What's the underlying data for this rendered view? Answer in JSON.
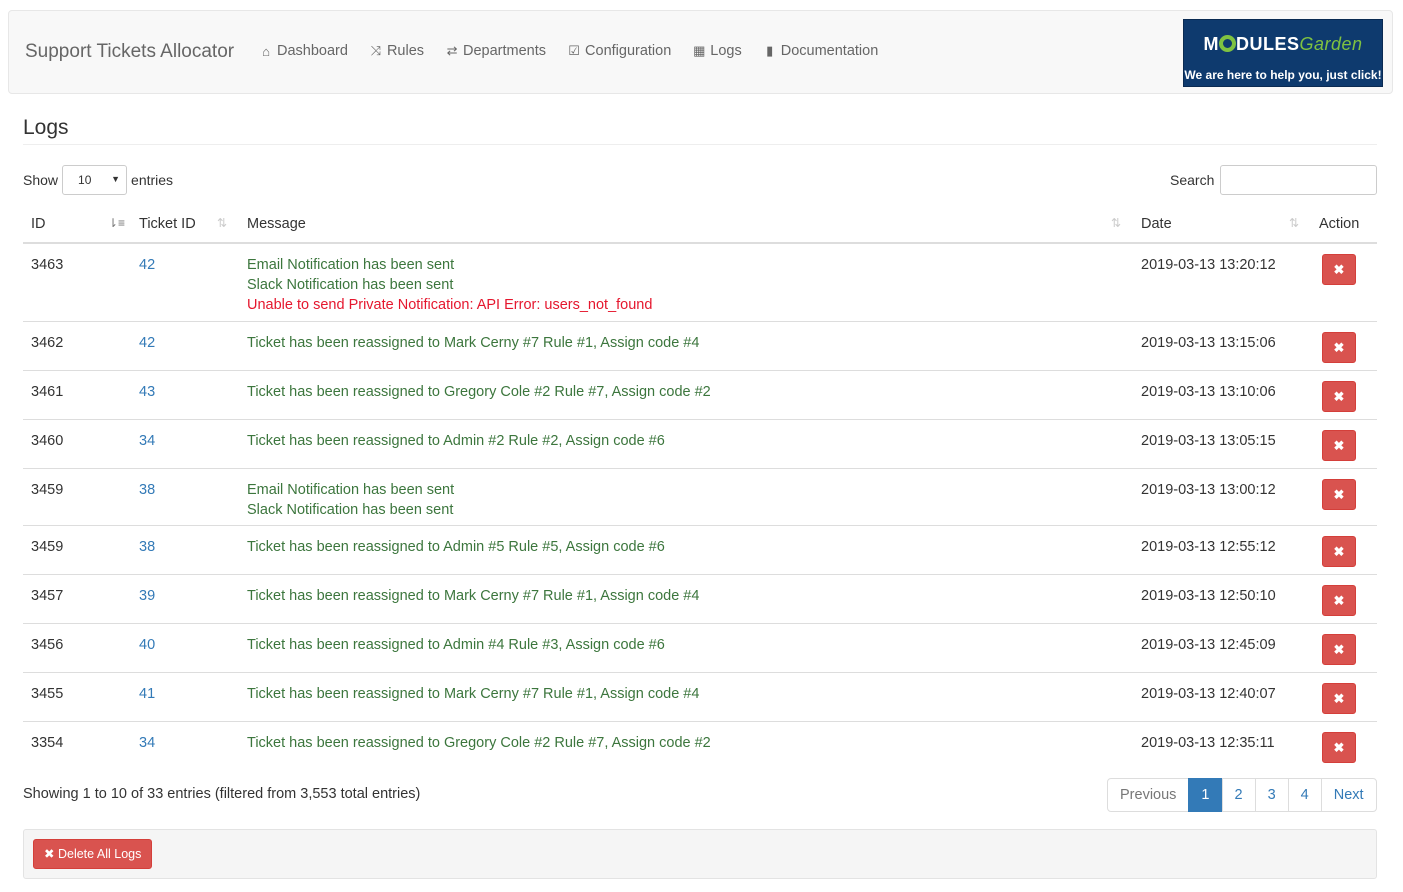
{
  "navbar": {
    "brand": "Support Tickets Allocator",
    "items": [
      {
        "icon": "home-icon",
        "glyph": "⌂",
        "label": "Dashboard"
      },
      {
        "icon": "random-icon",
        "glyph": "⤨",
        "label": "Rules"
      },
      {
        "icon": "transfer-icon",
        "glyph": "⇄",
        "label": "Departments"
      },
      {
        "icon": "check-square-icon",
        "glyph": "☑",
        "label": "Configuration"
      },
      {
        "icon": "calendar-icon",
        "glyph": "▦",
        "label": "Logs"
      },
      {
        "icon": "book-icon",
        "glyph": "▮",
        "label": "Documentation"
      }
    ],
    "logo": {
      "brand_part1": "M",
      "brand_part2": "DULES",
      "brand_part3": "Garden",
      "tagline": "We are here to help you, just click!"
    }
  },
  "page_title": "Logs",
  "table_controls": {
    "show_label": "Show",
    "entries_label": "entries",
    "length_value": "10",
    "search_label": "Search",
    "search_value": ""
  },
  "columns": {
    "id": "ID",
    "ticket_id": "Ticket ID",
    "message": "Message",
    "date": "Date",
    "action": "Action"
  },
  "rows": [
    {
      "id": "3463",
      "ticket_id": "42",
      "messages": [
        {
          "text": "Email Notification has been sent",
          "status": "ok"
        },
        {
          "text": "Slack Notification has been sent",
          "status": "ok"
        },
        {
          "text": "Unable to send Private Notification: API Error: users_not_found",
          "status": "err"
        }
      ],
      "date": "2019-03-13 13:20:12"
    },
    {
      "id": "3462",
      "ticket_id": "42",
      "messages": [
        {
          "text": "Ticket has been reassigned to Mark Cerny #7 Rule #1, Assign code #4",
          "status": "ok"
        }
      ],
      "date": "2019-03-13 13:15:06"
    },
    {
      "id": "3461",
      "ticket_id": "43",
      "messages": [
        {
          "text": "Ticket has been reassigned to Gregory Cole #2 Rule #7, Assign code #2",
          "status": "ok"
        }
      ],
      "date": "2019-03-13 13:10:06"
    },
    {
      "id": "3460",
      "ticket_id": "34",
      "messages": [
        {
          "text": "Ticket has been reassigned to Admin #2 Rule #2, Assign code #6",
          "status": "ok"
        }
      ],
      "date": "2019-03-13 13:05:15"
    },
    {
      "id": "3459",
      "ticket_id": "38",
      "messages": [
        {
          "text": "Email Notification has been sent",
          "status": "ok"
        },
        {
          "text": "Slack Notification has been sent",
          "status": "ok"
        }
      ],
      "date": "2019-03-13 13:00:12"
    },
    {
      "id": "3459",
      "ticket_id": "38",
      "messages": [
        {
          "text": "Ticket has been reassigned to Admin #5 Rule #5, Assign code #6",
          "status": "ok"
        }
      ],
      "date": "2019-03-13 12:55:12"
    },
    {
      "id": "3457",
      "ticket_id": "39",
      "messages": [
        {
          "text": "Ticket has been reassigned to Mark Cerny #7 Rule #1, Assign code #4",
          "status": "ok"
        }
      ],
      "date": "2019-03-13 12:50:10"
    },
    {
      "id": "3456",
      "ticket_id": "40",
      "messages": [
        {
          "text": "Ticket has been reassigned to Admin #4 Rule #3, Assign code #6",
          "status": "ok"
        }
      ],
      "date": "2019-03-13 12:45:09"
    },
    {
      "id": "3455",
      "ticket_id": "41",
      "messages": [
        {
          "text": "Ticket has been reassigned to Mark Cerny #7 Rule #1, Assign code #4",
          "status": "ok"
        }
      ],
      "date": "2019-03-13 12:40:07"
    },
    {
      "id": "3354",
      "ticket_id": "34",
      "messages": [
        {
          "text": "Ticket has been reassigned to Gregory Cole #2 Rule #7, Assign code #2",
          "status": "ok"
        }
      ],
      "date": "2019-03-13 12:35:11"
    }
  ],
  "delete_icon": "times-icon",
  "delete_glyph": "✖",
  "info_text": "Showing 1 to 10 of 33 entries (filtered from 3,553 total entries)",
  "pagination": {
    "previous": "Previous",
    "pages": [
      "1",
      "2",
      "3",
      "4"
    ],
    "active_page": "1",
    "next": "Next"
  },
  "footer": {
    "delete_all_label": "Delete All Logs",
    "delete_all_glyph": "✖"
  },
  "colors": {
    "success_text": "#3c763d",
    "error_text": "#e5172e",
    "link": "#337ab7",
    "danger": "#d9534f",
    "logo_bg": "#0e3a6e",
    "logo_accent": "#7fc241"
  }
}
